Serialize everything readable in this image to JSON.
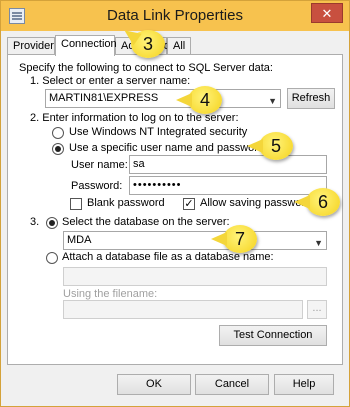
{
  "window": {
    "title": "Data Link Properties",
    "close_glyph": "✕"
  },
  "tabs": [
    "Provider",
    "Connection",
    "Advanced",
    "All"
  ],
  "instructions": "Specify the following to connect to SQL Server data:",
  "step1": {
    "label": "1. Select or enter a server name:",
    "server": "MARTIN81\\EXPRESS",
    "refresh": "Refresh"
  },
  "step2": {
    "label": "2. Enter information to log on to the server:",
    "opt_windows": "Use Windows NT Integrated security",
    "opt_specific": "Use a specific user name and password:",
    "username_label": "User name:",
    "username": "sa",
    "password_label": "Password:",
    "password": "••••••••••",
    "blank_password": "Blank password",
    "allow_saving": "Allow saving password",
    "allow_check": "✓"
  },
  "step3": {
    "num": "3.",
    "select_db": "Select the database on the server:",
    "database": "MDA",
    "attach": "Attach a database file as a database name:",
    "using_filename": "Using the filename:",
    "browse": "...",
    "test": "Test Connection"
  },
  "buttons": {
    "ok": "OK",
    "cancel": "Cancel",
    "help": "Help"
  },
  "callouts": [
    "3",
    "4",
    "5",
    "6",
    "7"
  ]
}
